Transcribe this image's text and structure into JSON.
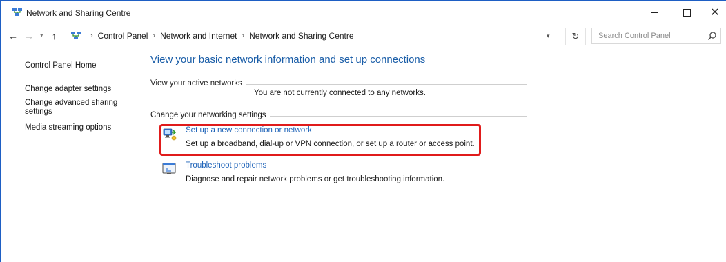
{
  "window": {
    "title": "Network and Sharing Centre",
    "controls": {
      "minimize": "—",
      "maximize": "☐",
      "close": "✕"
    }
  },
  "address_bar": {
    "breadcrumbs": [
      "Control Panel",
      "Network and Internet",
      "Network and Sharing Centre"
    ],
    "search_placeholder": "Search Control Panel"
  },
  "sidebar": {
    "items": [
      {
        "label": "Control Panel Home"
      },
      {
        "label": "Change adapter settings"
      },
      {
        "label": "Change advanced sharing settings"
      },
      {
        "label": "Media streaming options"
      }
    ]
  },
  "main": {
    "title": "View your basic network information and set up connections",
    "active_networks": {
      "label": "View your active networks",
      "status": "You are not currently connected to any networks."
    },
    "settings": {
      "label": "Change your networking settings",
      "tasks": [
        {
          "icon": "new-connection-icon",
          "link": "Set up a new connection or network",
          "description": "Set up a broadband, dial-up or VPN connection, or set up a router or access point."
        },
        {
          "icon": "troubleshoot-icon",
          "link": "Troubleshoot problems",
          "description": "Diagnose and repair network problems or get troubleshooting information."
        }
      ]
    }
  },
  "colors": {
    "link": "#1e63b8",
    "title": "#1b5ea8",
    "highlight": "#e01b1b",
    "window_border": "#1e5fc4"
  }
}
